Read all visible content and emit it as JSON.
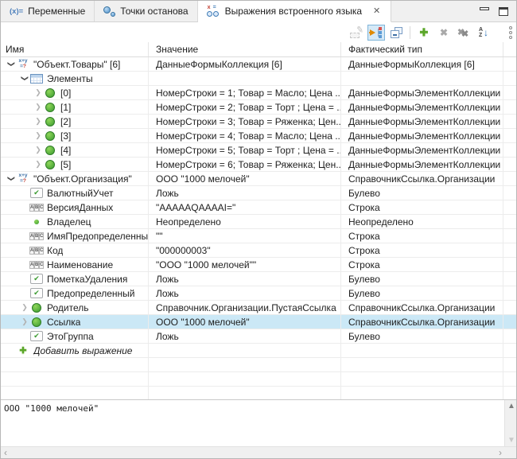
{
  "tabs": [
    {
      "label": "Переменные",
      "icon": "variables-icon",
      "active": false
    },
    {
      "label": "Точки останова",
      "icon": "breakpoints-icon",
      "active": false
    },
    {
      "label": "Выражения встроенного языка",
      "icon": "expressions-icon",
      "active": true,
      "closable": true
    }
  ],
  "toolbar": {
    "buttons": [
      {
        "name": "compute-expression",
        "state": "disabled"
      },
      {
        "name": "auto-show-current",
        "state": "toggled"
      },
      {
        "name": "collapse-all",
        "state": "normal"
      },
      {
        "name": "add-expression",
        "state": "normal"
      },
      {
        "name": "delete-expression",
        "state": "disabled"
      },
      {
        "name": "delete-all-expressions",
        "state": "disabled"
      },
      {
        "name": "sort-az",
        "state": "normal"
      },
      {
        "name": "more-commands",
        "state": "normal"
      }
    ]
  },
  "table": {
    "columns": {
      "name": "Имя",
      "value": "Значение",
      "type": "Фактический тип"
    },
    "rows": [
      {
        "level": 0,
        "exp": "expanded",
        "icon": "expr",
        "name": "\"Объект.Товары\" [6]",
        "value": "ДанныеФормыКоллекция [6]",
        "type": "ДанныеФормыКоллекция [6]"
      },
      {
        "level": 1,
        "exp": "expanded",
        "icon": "table",
        "name": "Элементы",
        "value": "",
        "type": ""
      },
      {
        "level": 2,
        "exp": "collapsed",
        "icon": "circle",
        "name": "[0]",
        "value": "НомерСтроки = 1; Товар = Масло; Цена ...",
        "type": "ДанныеФормыЭлементКоллекции"
      },
      {
        "level": 2,
        "exp": "collapsed",
        "icon": "circle",
        "name": "[1]",
        "value": "НомерСтроки = 2; Товар = Торт ; Цена = ...",
        "type": "ДанныеФормыЭлементКоллекции"
      },
      {
        "level": 2,
        "exp": "collapsed",
        "icon": "circle",
        "name": "[2]",
        "value": "НомерСтроки = 3; Товар = Ряженка; Цен...",
        "type": "ДанныеФормыЭлементКоллекции"
      },
      {
        "level": 2,
        "exp": "collapsed",
        "icon": "circle",
        "name": "[3]",
        "value": "НомерСтроки = 4; Товар = Масло; Цена ...",
        "type": "ДанныеФормыЭлементКоллекции"
      },
      {
        "level": 2,
        "exp": "collapsed",
        "icon": "circle",
        "name": "[4]",
        "value": "НомерСтроки = 5; Товар = Торт ; Цена = ...",
        "type": "ДанныеФормыЭлементКоллекции"
      },
      {
        "level": 2,
        "exp": "collapsed",
        "icon": "circle",
        "name": "[5]",
        "value": "НомерСтроки = 6; Товар = Ряженка; Цен...",
        "type": "ДанныеФормыЭлементКоллекции"
      },
      {
        "level": 0,
        "exp": "expanded",
        "icon": "expr",
        "name": "\"Объект.Организация\"",
        "value": "ООО \"1000 мелочей\"",
        "type": "СправочникСсылка.Организации"
      },
      {
        "level": 1,
        "exp": "none",
        "icon": "check",
        "name": "ВалютныйУчет",
        "value": "Ложь",
        "type": "Булево"
      },
      {
        "level": 1,
        "exp": "none",
        "icon": "abc",
        "name": "ВерсияДанных",
        "value": "\"AAAAAQAAAAI=\"",
        "type": "Строка"
      },
      {
        "level": 1,
        "exp": "none",
        "icon": "dot",
        "name": "Владелец",
        "value": "Неопределено",
        "type": "Неопределено"
      },
      {
        "level": 1,
        "exp": "none",
        "icon": "abc",
        "name": "ИмяПредопределенныхДанных",
        "value": "\"\"",
        "type": "Строка"
      },
      {
        "level": 1,
        "exp": "none",
        "icon": "abc",
        "name": "Код",
        "value": "\"000000003\"",
        "type": "Строка"
      },
      {
        "level": 1,
        "exp": "none",
        "icon": "abc",
        "name": "Наименование",
        "value": "\"ООО \"1000 мелочей\"\"",
        "type": "Строка"
      },
      {
        "level": 1,
        "exp": "none",
        "icon": "check",
        "name": "ПометкаУдаления",
        "value": "Ложь",
        "type": "Булево"
      },
      {
        "level": 1,
        "exp": "none",
        "icon": "check",
        "name": "Предопределенный",
        "value": "Ложь",
        "type": "Булево"
      },
      {
        "level": 1,
        "exp": "collapsed",
        "icon": "circle",
        "name": "Родитель",
        "value": "Справочник.Организации.ПустаяСсылка",
        "type": "СправочникСсылка.Организации"
      },
      {
        "level": 1,
        "exp": "collapsed",
        "icon": "circle",
        "name": "Ссылка",
        "value": "ООО \"1000 мелочей\"",
        "type": "СправочникСсылка.Организации",
        "selected": true
      },
      {
        "level": 1,
        "exp": "none",
        "icon": "check",
        "name": "ЭтоГруппа",
        "value": "Ложь",
        "type": "Булево"
      },
      {
        "level": 0,
        "exp": "none",
        "icon": "plus",
        "name": "Добавить выражение",
        "value": "",
        "type": "",
        "add": true
      }
    ],
    "empty_rows": 3
  },
  "bottom_panel": {
    "text": "ООО \"1000 мелочей\""
  },
  "colors": {
    "selection": "#cbe8f6",
    "toolbar_toggle_bg": "#d5e9f7",
    "accent_green": "#3a9b2f",
    "accent_blue": "#3d7ab5"
  }
}
